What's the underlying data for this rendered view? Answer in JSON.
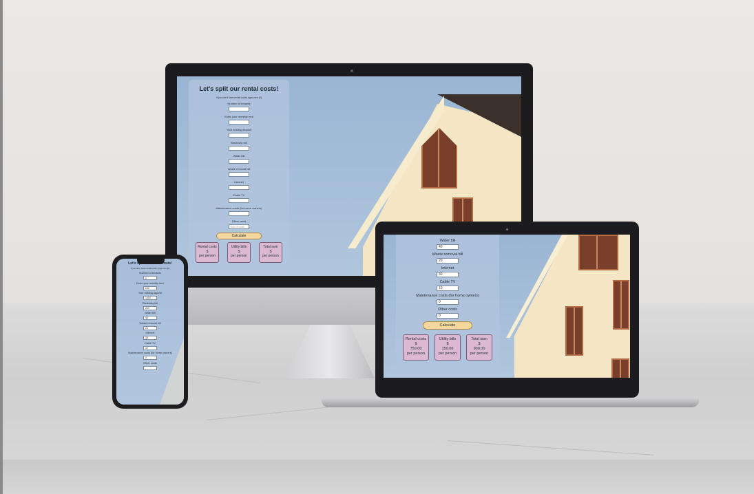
{
  "desktop": {
    "title": "Let's split our rental costs!",
    "note": "If you don't have rental costs, type zero (0)",
    "fields": [
      {
        "label": "Number of tenants",
        "value": "",
        "placeholder": ""
      },
      {
        "label": "Enter your monthly rent",
        "value": "",
        "placeholder": ""
      },
      {
        "label": "Your holding deposit",
        "value": "",
        "placeholder": ""
      },
      {
        "label": "Electricity bill",
        "value": "",
        "placeholder": ""
      },
      {
        "label": "Water bill",
        "value": "",
        "placeholder": ""
      },
      {
        "label": "Waste removal bill",
        "value": "",
        "placeholder": ""
      },
      {
        "label": "Internet",
        "value": "",
        "placeholder": ""
      },
      {
        "label": "Cable TV",
        "value": "",
        "placeholder": ""
      },
      {
        "label": "Maintenance costs (for home owners)",
        "value": "",
        "placeholder": ""
      },
      {
        "label": "Other costs",
        "value": "",
        "placeholder": "sum of costs"
      }
    ],
    "calculate_label": "Calculate",
    "cards": [
      {
        "title": "Rental costs",
        "currency": "$",
        "amount": "",
        "unit": "per person"
      },
      {
        "title": "Utility bills",
        "currency": "$",
        "amount": "",
        "unit": "per person"
      },
      {
        "title": "Total sum",
        "currency": "$",
        "amount": "",
        "unit": "per person"
      }
    ]
  },
  "laptop": {
    "fields": [
      {
        "label": "Water bill",
        "value": "40"
      },
      {
        "label": "Waste removal bill",
        "value": "20"
      },
      {
        "label": "Internet",
        "value": "30"
      },
      {
        "label": "Cable TV",
        "value": "10"
      },
      {
        "label": "Maintenance costs (for home owners)",
        "value": "0"
      },
      {
        "label": "Other costs",
        "value": "0"
      }
    ],
    "calculate_label": "Calculate",
    "cards": [
      {
        "title": "Rental costs",
        "currency": "$",
        "amount": "750.00",
        "unit": "per person"
      },
      {
        "title": "Utility bills",
        "currency": "$",
        "amount": "150.00",
        "unit": "per person"
      },
      {
        "title": "Total sum",
        "currency": "$",
        "amount": "900.00",
        "unit": "per person"
      }
    ]
  },
  "phone": {
    "title": "Let's split our rental costs!",
    "note": "If you don't have rental costs, type zero (0)",
    "fields": [
      {
        "label": "Number of tenants",
        "value": "2"
      },
      {
        "label": "Enter your monthly rent",
        "value": "600"
      },
      {
        "label": "Your holding deposit",
        "value": "1000"
      },
      {
        "label": "Electricity bill",
        "value": "200"
      },
      {
        "label": "Water bill",
        "value": "40"
      },
      {
        "label": "Waste removal bill",
        "value": "20"
      },
      {
        "label": "Internet",
        "value": "30"
      },
      {
        "label": "Cable TV",
        "value": "10"
      },
      {
        "label": "Maintenance costs (for home owners)",
        "value": "0"
      },
      {
        "label": "Other costs",
        "value": ""
      }
    ]
  },
  "colors": {
    "sky": "#9ab5d3",
    "panel": "#b2c4de",
    "button": "#f3d79c",
    "card": "#dcb9d3",
    "house": "#f4e6c4",
    "window_frame": "#7a3f2a"
  }
}
